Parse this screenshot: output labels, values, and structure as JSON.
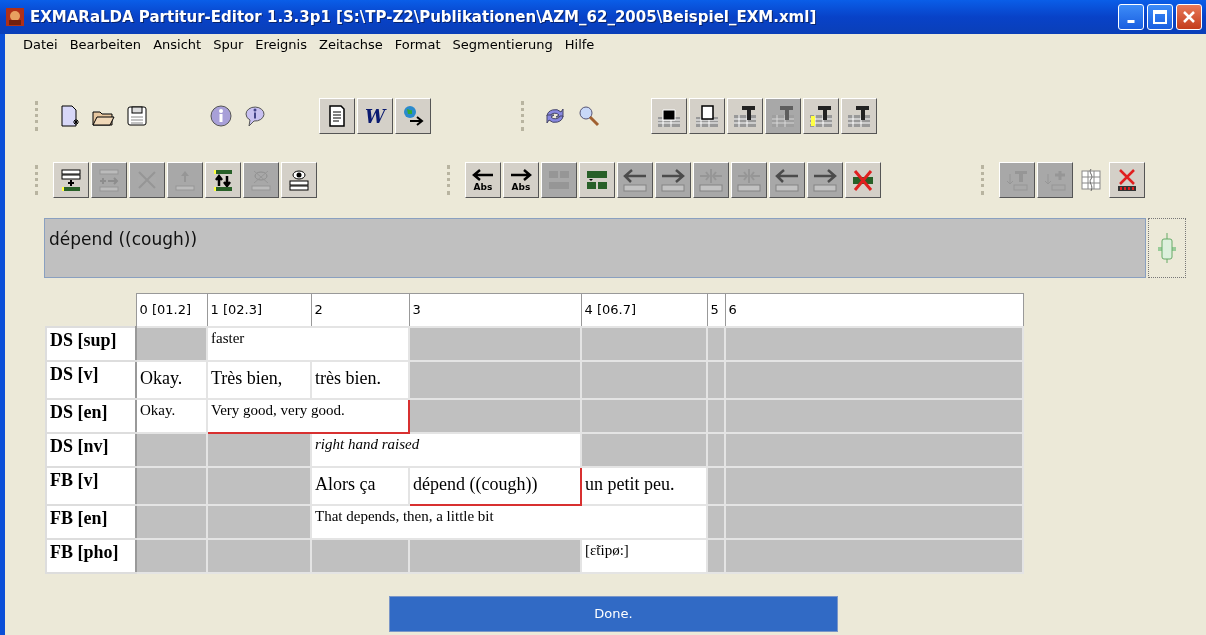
{
  "window": {
    "title": "EXMARaLDA Partitur-Editor 1.3.3p1 [S:\\TP-Z2\\Publikationen\\AZM_62_2005\\Beispiel_EXM.xml]"
  },
  "menu": [
    "Datei",
    "Bearbeiten",
    "Ansicht",
    "Spur",
    "Ereignis",
    "Zeitachse",
    "Format",
    "Segmentierung",
    "Hilfe"
  ],
  "toolbars": [
    {
      "groups": [
        {
          "buttons": [
            {
              "kind": "new-file",
              "disabled": false
            },
            {
              "kind": "open-folder",
              "disabled": false
            },
            {
              "kind": "save",
              "disabled": false
            }
          ]
        },
        {
          "buttons": [
            {
              "kind": "info-circle",
              "disabled": false
            },
            {
              "kind": "info-bubble",
              "disabled": false
            }
          ]
        },
        {
          "buttons": [
            {
              "kind": "text-doc",
              "disabled": false
            },
            {
              "kind": "word",
              "label": "W",
              "disabled": false
            },
            {
              "kind": "globe-arrow",
              "disabled": false
            }
          ]
        },
        {
          "buttons": [
            {
              "kind": "refresh",
              "disabled": false
            },
            {
              "kind": "search",
              "disabled": false
            }
          ]
        },
        {
          "buttons": [
            {
              "kind": "brick-open",
              "disabled": false
            },
            {
              "kind": "brick-save",
              "disabled": false
            },
            {
              "kind": "brick-hammer",
              "disabled": false
            },
            {
              "kind": "brick-hammer",
              "disabled": true
            },
            {
              "kind": "brick-hammer-yellow",
              "disabled": false
            },
            {
              "kind": "brick-hammer",
              "disabled": false
            }
          ]
        }
      ]
    },
    {
      "groups": [
        {
          "buttons": [
            {
              "kind": "add-row",
              "disabled": false
            },
            {
              "kind": "insert-arrow",
              "disabled": true
            },
            {
              "kind": "cross",
              "disabled": true
            },
            {
              "kind": "up",
              "disabled": true
            },
            {
              "kind": "swap-rows",
              "disabled": false
            },
            {
              "kind": "eye-crossed",
              "disabled": true
            },
            {
              "kind": "eye-row",
              "disabled": false
            }
          ]
        },
        {
          "buttons": [
            {
              "kind": "arrow-left",
              "label": "Abs",
              "disabled": false
            },
            {
              "kind": "arrow-right",
              "label": "Abs",
              "disabled": false
            },
            {
              "kind": "merge-down",
              "disabled": true
            },
            {
              "kind": "split",
              "disabled": false
            },
            {
              "kind": "arrow-left",
              "disabled": true
            },
            {
              "kind": "arrow-right",
              "disabled": true
            },
            {
              "kind": "join",
              "disabled": true
            },
            {
              "kind": "join",
              "disabled": true
            },
            {
              "kind": "arrow-left",
              "disabled": true
            },
            {
              "kind": "arrow-right",
              "disabled": true
            },
            {
              "kind": "delete-green",
              "disabled": false
            }
          ]
        },
        {
          "buttons": [
            {
              "kind": "hammer-down",
              "disabled": true
            },
            {
              "kind": "plus-down",
              "disabled": true
            },
            {
              "kind": "columns",
              "disabled": false
            },
            {
              "kind": "delete-red",
              "disabled": false
            }
          ]
        }
      ]
    }
  ],
  "editor": {
    "value": "dépend ((cough))"
  },
  "partitur": {
    "columns": [
      "0 [01.2]",
      "1 [02.3]",
      "2",
      "3",
      "4 [06.7]",
      "5",
      "6"
    ],
    "tiers": [
      {
        "label": "DS [sup]",
        "kind": "annotation",
        "cells": [
          {
            "kind": "empty"
          },
          {
            "kind": "event",
            "text": "faster",
            "selected": false
          },
          {
            "kind": "joined"
          },
          {
            "kind": "empty"
          },
          {
            "kind": "empty"
          },
          {
            "kind": "empty"
          },
          {
            "kind": "empty"
          }
        ]
      },
      {
        "label": "DS [v]",
        "kind": "verbal",
        "cells": [
          {
            "kind": "event",
            "text": "Okay.",
            "selected": false
          },
          {
            "kind": "event",
            "text": "Très bien,",
            "selected": false
          },
          {
            "kind": "event",
            "text": "très bien.",
            "selected": false
          },
          {
            "kind": "empty"
          },
          {
            "kind": "empty"
          },
          {
            "kind": "empty"
          },
          {
            "kind": "empty"
          }
        ]
      },
      {
        "label": "DS [en]",
        "kind": "annotation",
        "cells": [
          {
            "kind": "event",
            "text": "Okay.",
            "selected": false
          },
          {
            "kind": "event",
            "text": "Very good, very good.",
            "selected": true
          },
          {
            "kind": "joined"
          },
          {
            "kind": "empty"
          },
          {
            "kind": "empty"
          },
          {
            "kind": "empty"
          },
          {
            "kind": "empty"
          }
        ]
      },
      {
        "label": "DS [nv]",
        "kind": "annotation",
        "cells": [
          {
            "kind": "empty"
          },
          {
            "kind": "empty"
          },
          {
            "kind": "event",
            "text": "right hand raised",
            "selected": false,
            "italic": true
          },
          {
            "kind": "joined"
          },
          {
            "kind": "empty"
          },
          {
            "kind": "empty"
          },
          {
            "kind": "empty"
          }
        ]
      },
      {
        "label": "FB [v]",
        "kind": "verbal",
        "cells": [
          {
            "kind": "empty"
          },
          {
            "kind": "empty"
          },
          {
            "kind": "event",
            "text": "Alors ça",
            "selected": false
          },
          {
            "kind": "event",
            "text": "dépend ((cough))",
            "selected": true
          },
          {
            "kind": "event",
            "text": "un petit peu.",
            "selected": false
          },
          {
            "kind": "empty"
          },
          {
            "kind": "empty"
          }
        ]
      },
      {
        "label": "FB [en]",
        "kind": "annotation",
        "cells": [
          {
            "kind": "empty"
          },
          {
            "kind": "empty"
          },
          {
            "kind": "event",
            "text": "That depends, then, a little bit",
            "selected": false
          },
          {
            "kind": "joined"
          },
          {
            "kind": "joined"
          },
          {
            "kind": "empty"
          },
          {
            "kind": "empty"
          }
        ]
      },
      {
        "label": "FB [pho]",
        "kind": "annotation",
        "cells": [
          {
            "kind": "empty"
          },
          {
            "kind": "empty"
          },
          {
            "kind": "empty"
          },
          {
            "kind": "empty"
          },
          {
            "kind": "event",
            "text": "[ɛ̃tipø:]",
            "selected": false
          },
          {
            "kind": "empty"
          },
          {
            "kind": "empty"
          }
        ]
      }
    ]
  },
  "status": {
    "text": "Done.",
    "level": 1
  }
}
